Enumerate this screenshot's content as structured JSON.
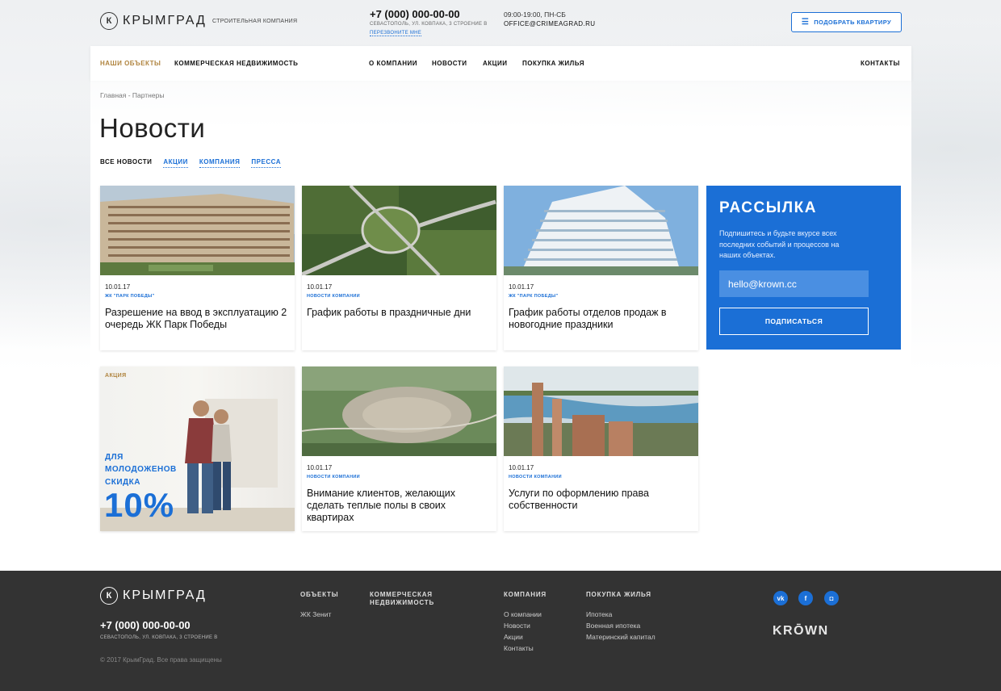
{
  "brand": {
    "name": "КРЫМГРАД",
    "mark": "К",
    "tagline": "СТРОИТЕЛЬНАЯ КОМПАНИЯ"
  },
  "contacts": {
    "phone": "+7 (000) 000-00-00",
    "address": "СЕВАСТОПОЛЬ, УЛ. КОВПАКА, 3 СТРОЕНИЕ В",
    "callback": "ПЕРЕЗВОНИТЕ МНЕ",
    "hours": "09:00-19:00, ПН-СБ",
    "email": "OFFICE@CRIMEAGRAD.RU"
  },
  "pick_button": {
    "label": "ПОДОБРАТЬ КВАРТИРУ",
    "icon": "sliders-icon"
  },
  "nav": {
    "objects": "НАШИ ОБЪЕКТЫ",
    "commercial": "КОММЕРЧЕСКАЯ НЕДВИЖИМОСТЬ",
    "about": "О КОМПАНИИ",
    "news": "НОВОСТИ",
    "promos": "АКЦИИ",
    "buying": "ПОКУПКА ЖИЛЬЯ",
    "contacts": "КОНТАКТЫ"
  },
  "breadcrumb": "Главная - Партнеры",
  "page_title": "Новости",
  "filters": {
    "all": "ВСЕ НОВОСТИ",
    "promos": "АКЦИИ",
    "company": "КОМПАНИЯ",
    "press": "ПРЕССА"
  },
  "cards": [
    {
      "date": "10.01.17",
      "category": "ЖК \"ПАРК ПОБЕДЫ\"",
      "title": "Разрешение на ввод в эксплуатацию 2 очередь ЖК Парк Победы"
    },
    {
      "date": "10.01.17",
      "category": "НОВОСТИ КОМПАНИИ",
      "title": "График работы в праздничные дни"
    },
    {
      "date": "10.01.17",
      "category": "ЖК \"ПАРК ПОБЕДЫ\"",
      "title": "График работы отделов продаж в новогодние праздники"
    },
    {
      "date": "10.01.17",
      "category": "НОВОСТИ КОМПАНИИ",
      "title": "Внимание клиентов, желающих сделать теплые полы в своих квартирах"
    },
    {
      "date": "10.01.17",
      "category": "НОВОСТИ КОМПАНИИ",
      "title": "Услуги по оформлению права собственности"
    }
  ],
  "subscribe": {
    "title": "РАССЫЛКА",
    "text": "Подпишитесь и будьте вкурсе всех последних событий и процессов на наших объектах.",
    "placeholder": "hello@krown.cc",
    "button": "ПОДПИСАТЬСЯ"
  },
  "promo": {
    "tag": "АКЦИЯ",
    "line1": "ДЛЯ",
    "line2": "МОЛОДОЖЕНОВ",
    "line3": "СКИДКА",
    "big": "10%"
  },
  "footer": {
    "phone": "+7 (000) 000-00-00",
    "address": "СЕВАСТОПОЛЬ, УЛ. КОВПАКА, 3 СТРОЕНИЕ В",
    "copyright": "© 2017 КрымГрад. Все права защищены",
    "col_objects": {
      "title": "ОБЪЕКТЫ",
      "items": [
        "ЖК Зенит"
      ]
    },
    "col_commercial": {
      "title1": "КОММЕРЧЕСКАЯ",
      "title2": "НЕДВИЖИМОСТЬ"
    },
    "col_company": {
      "title": "КОМПАНИЯ",
      "items": [
        "О компании",
        "Новости",
        "Акции",
        "Контакты"
      ]
    },
    "col_buying": {
      "title": "ПОКУПКА ЖИЛЬЯ",
      "items": [
        "Ипотека",
        "Военная ипотека",
        "Материнский капитал"
      ]
    },
    "social": {
      "vk": "vk",
      "fb": "f",
      "ig": "◘"
    },
    "developer": "KRŌWN"
  },
  "colors": {
    "accent": "#1b6fd6",
    "gold": "#b0843f",
    "footer_bg": "#333333"
  }
}
